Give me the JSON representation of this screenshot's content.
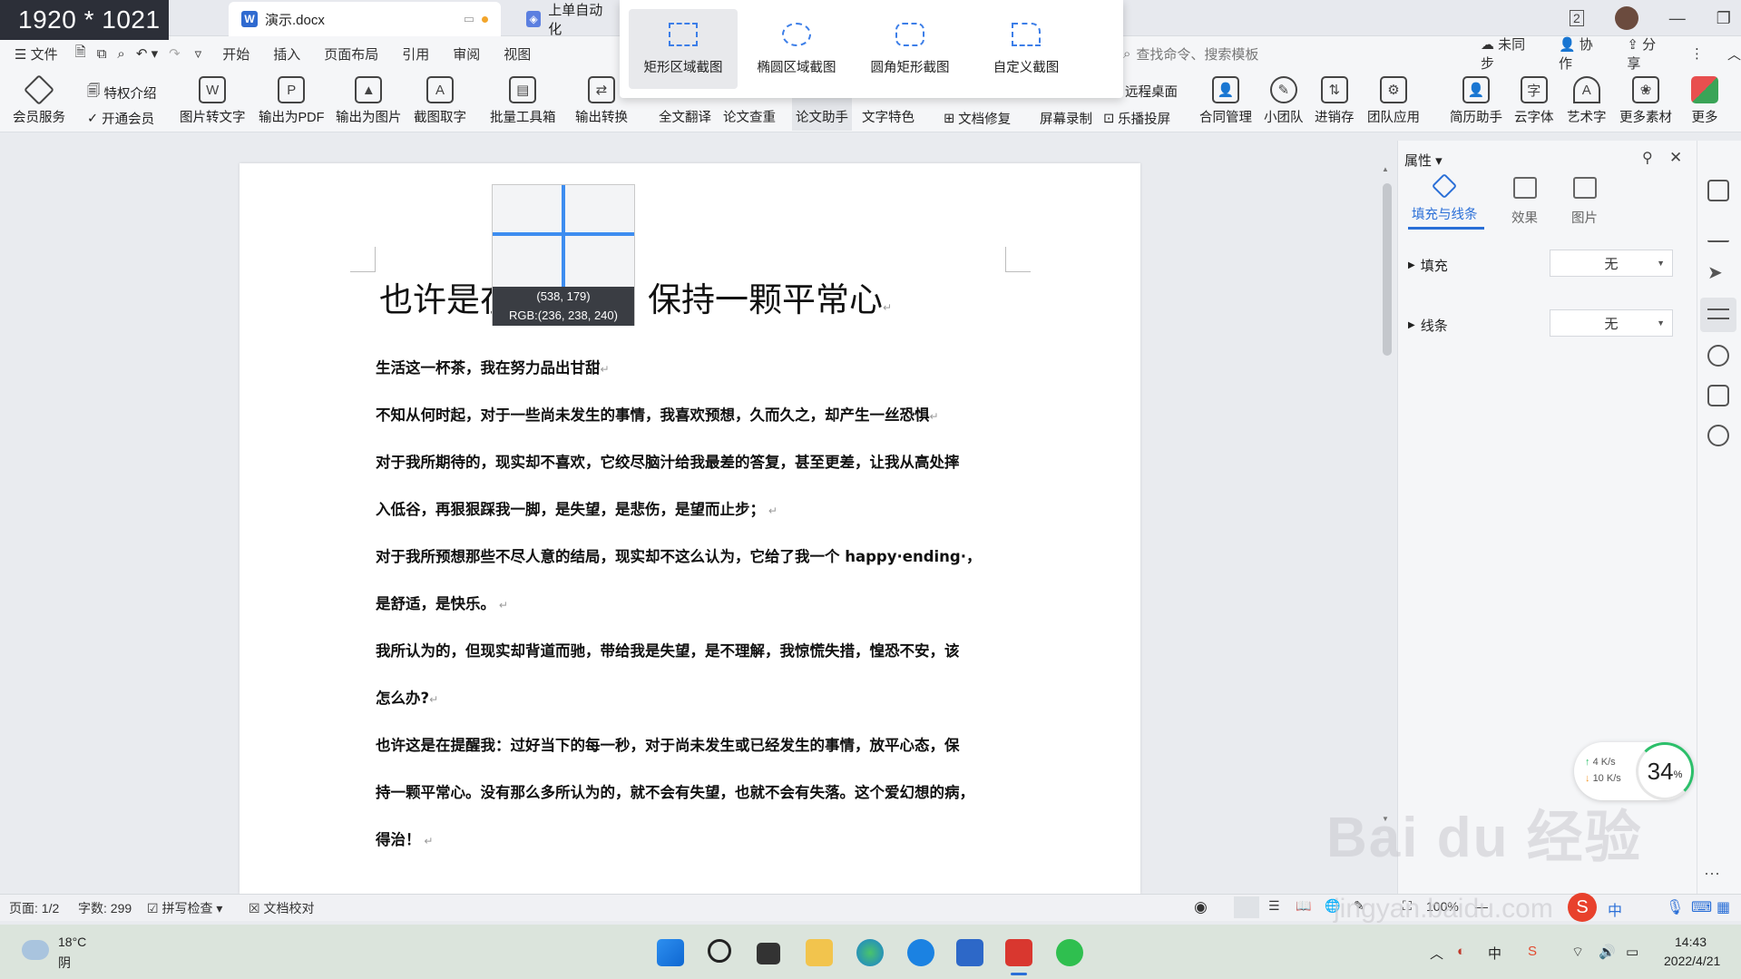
{
  "overlay_dimensions": "1920 * 1021",
  "tabs": [
    {
      "label": "演示.docx",
      "active": true
    },
    {
      "label": "上单自动化"
    }
  ],
  "menu": {
    "file": "文件",
    "items": [
      "开始",
      "插入",
      "页面布局",
      "引用",
      "审阅",
      "视图"
    ],
    "search_placeholder": "查找命令、搜索模板",
    "sync": "未同步",
    "collab": "协作",
    "share": "分享"
  },
  "screenshot_menu": [
    "矩形区域截图",
    "椭圆区域截图",
    "圆角矩形截图",
    "自定义截图"
  ],
  "ribbon": {
    "member": "会员服务",
    "privilege": "特权介绍",
    "open_member": "开通会员",
    "tools": [
      "图片转文字",
      "输出为PDF",
      "输出为图片",
      "截图取字",
      "批量工具箱",
      "输出转换",
      "全文翻译",
      "论文查重",
      "论文助手",
      "文字特色"
    ],
    "doc_repair": "文档修复",
    "remote_desktop": "远程桌面",
    "screen_record": "屏幕录制",
    "cast_screen": "乐播投屏",
    "apps": [
      "合同管理",
      "小团队",
      "进销存",
      "团队应用",
      "简历助手",
      "云字体",
      "艺术字",
      "更多素材",
      "更多"
    ]
  },
  "document": {
    "title": "也许是在提醒我：保持一颗平常心",
    "paragraphs": [
      "生活这一杯茶，我在努力品出甘甜",
      "不知从何时起，对于一些尚未发生的事情，我喜欢预想，久而久之，却产生一丝恐惧",
      "对于我所期待的，现实却不喜欢，它绞尽脑汁给我最差的答复，甚至更差，让我从高处摔",
      "入低谷，再狠狠踩我一脚，是失望，是悲伤，是望而止步；",
      "对于我所预想那些不尽人意的结局，现实却不这么认为，它给了我一个 happy·ending·，",
      "是舒适，是快乐。",
      "我所认为的，但现实却背道而驰，带给我是失望，是不理解，我惊慌失措，惶恐不安，该",
      "怎么办?",
      "也许这是在提醒我：过好当下的每一秒，对于尚未发生或已经发生的事情，放平心态，保",
      "持一颗平常心。没有那么多所认为的，就不会有失望，也就不会有失落。这个爱幻想的病，",
      "得治！"
    ]
  },
  "magnifier": {
    "coords": "(538, 179)",
    "rgb": "RGB:(236, 238, 240)"
  },
  "properties": {
    "header": "属性",
    "tabs": [
      "填充与线条",
      "效果",
      "图片"
    ],
    "fill_label": "填充",
    "fill_value": "无",
    "line_label": "线条",
    "line_value": "无"
  },
  "speed": {
    "up": "4",
    "down": "10",
    "unit": "K/s",
    "percent": "34",
    "percent_sign": "%"
  },
  "status": {
    "page": "页面: 1/2",
    "words": "字数: 299",
    "spell": "拼写检查",
    "proof": "文档校对",
    "zoom": "100%"
  },
  "taskbar": {
    "temp": "18°C",
    "weather": "阴",
    "ime": "中",
    "ime2": "中",
    "time": "14:43",
    "date": "2022/4/21"
  },
  "watermark": {
    "brand": "Bai du 经验",
    "url": "jingyan.baidu.com"
  },
  "colors": {
    "accent": "#2a6fd7",
    "crosshair": "#3d8df0",
    "overlay_bg": "#2c2f38"
  }
}
